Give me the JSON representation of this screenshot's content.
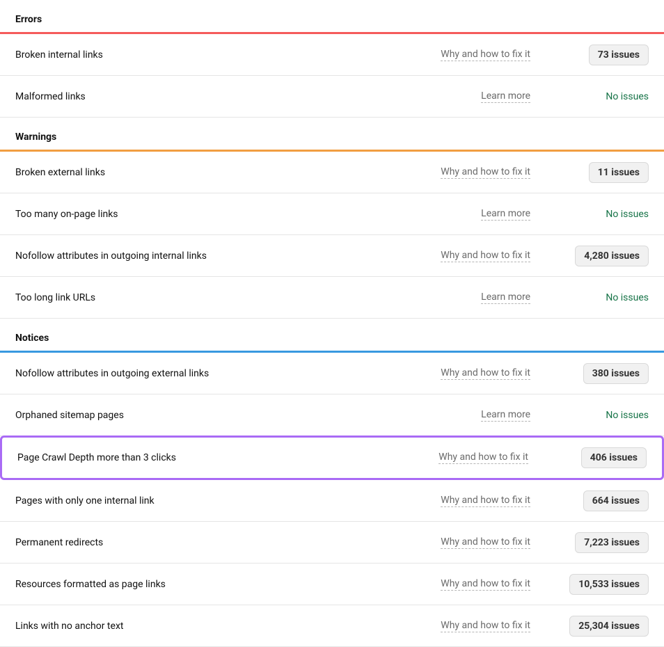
{
  "sections": {
    "errors": {
      "title": "Errors",
      "items": [
        {
          "name": "Broken internal links",
          "link": "Why and how to fix it",
          "count": "73 issues",
          "has_issues": true
        },
        {
          "name": "Malformed links",
          "link": "Learn more",
          "count": "No issues",
          "has_issues": false
        }
      ]
    },
    "warnings": {
      "title": "Warnings",
      "items": [
        {
          "name": "Broken external links",
          "link": "Why and how to fix it",
          "count": "11 issues",
          "has_issues": true
        },
        {
          "name": "Too many on-page links",
          "link": "Learn more",
          "count": "No issues",
          "has_issues": false
        },
        {
          "name": "Nofollow attributes in outgoing internal links",
          "link": "Why and how to fix it",
          "count": "4,280 issues",
          "has_issues": true
        },
        {
          "name": "Too long link URLs",
          "link": "Learn more",
          "count": "No issues",
          "has_issues": false
        }
      ]
    },
    "notices": {
      "title": "Notices",
      "items": [
        {
          "name": "Nofollow attributes in outgoing external links",
          "link": "Why and how to fix it",
          "count": "380 issues",
          "has_issues": true
        },
        {
          "name": "Orphaned sitemap pages",
          "link": "Learn more",
          "count": "No issues",
          "has_issues": false
        },
        {
          "name": "Page Crawl Depth more than 3 clicks",
          "link": "Why and how to fix it",
          "count": "406 issues",
          "has_issues": true,
          "highlighted": true
        },
        {
          "name": "Pages with only one internal link",
          "link": "Why and how to fix it",
          "count": "664 issues",
          "has_issues": true
        },
        {
          "name": "Permanent redirects",
          "link": "Why and how to fix it",
          "count": "7,223 issues",
          "has_issues": true
        },
        {
          "name": "Resources formatted as page links",
          "link": "Why and how to fix it",
          "count": "10,533 issues",
          "has_issues": true
        },
        {
          "name": "Links with no anchor text",
          "link": "Why and how to fix it",
          "count": "25,304 issues",
          "has_issues": true
        }
      ]
    }
  }
}
